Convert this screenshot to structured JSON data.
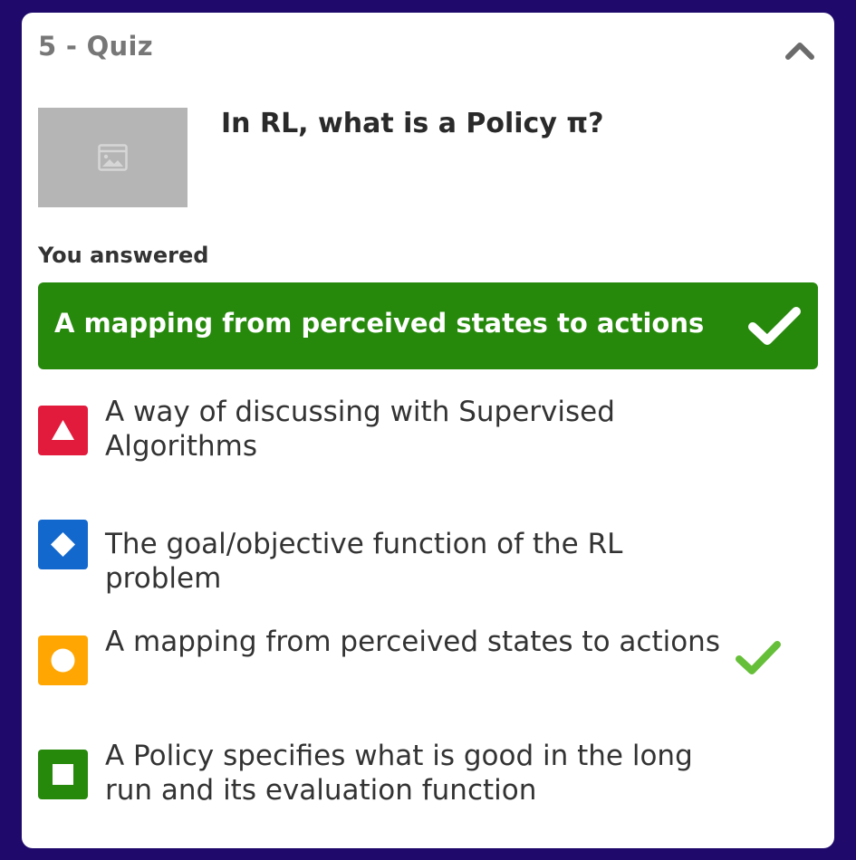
{
  "card": {
    "title": "5 - Quiz",
    "collapse_icon": "chevron-up-icon"
  },
  "question": {
    "image_icon": "image-placeholder-icon",
    "text": "In RL, what is a Policy π?"
  },
  "answered": {
    "label": "You answered",
    "answer_text": "A mapping from perceived states to actions",
    "result_icon": "check-icon",
    "color": "#26890c"
  },
  "options": [
    {
      "shape": "triangle-icon",
      "color": "#e21b3c",
      "text": "A way of discussing with Supervised Algorithms",
      "correct": false
    },
    {
      "shape": "diamond-icon",
      "color": "#1368ce",
      "text": "The goal/objective function of the RL problem",
      "correct": false
    },
    {
      "shape": "circle-icon",
      "color": "#ffa602",
      "text": "A mapping from perceived states to actions",
      "correct": true
    },
    {
      "shape": "square-icon",
      "color": "#26890c",
      "text": "A Policy specifies what is good in the long run and its evaluation function",
      "correct": false
    }
  ]
}
